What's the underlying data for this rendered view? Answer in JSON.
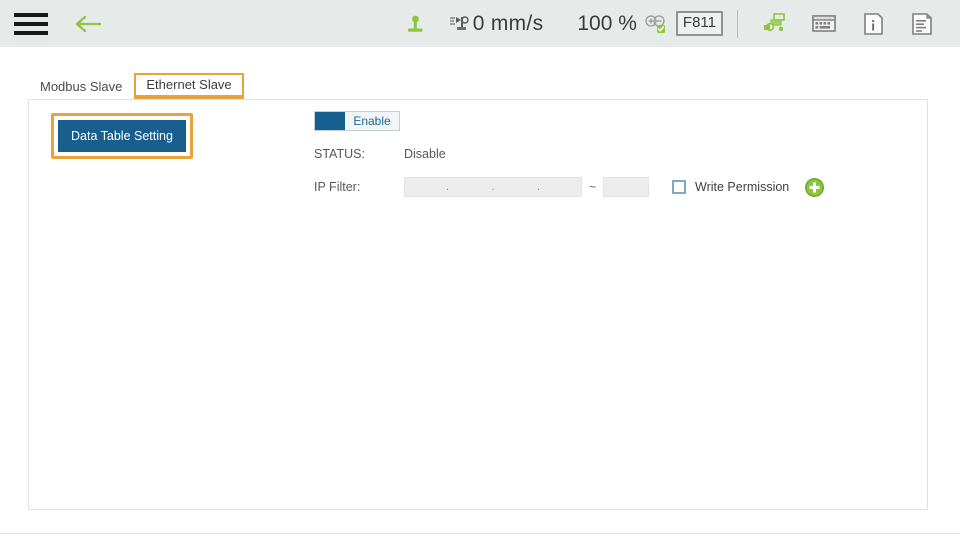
{
  "topbar": {
    "menu_icon": "hamburger-menu-icon",
    "back_icon": "back-arrow-icon",
    "robot_icon": "robot-home-icon",
    "speed_icon": "speed-icon",
    "speed_value": "0 mm/s",
    "zoom_value": "100 %",
    "zoom_icons": "zoom-in-out-icon",
    "frame_label": "F811",
    "program_icon": "program-tree-icon",
    "keyboard_icon": "keyboard-icon",
    "info_icon": "info-icon",
    "log_icon": "log-document-icon"
  },
  "tabs": [
    {
      "label": "Modbus Slave",
      "active": false
    },
    {
      "label": "Ethernet Slave",
      "active": true
    }
  ],
  "panel": {
    "data_table_button": "Data Table Setting",
    "enable_toggle_label": "Enable",
    "status_label": "STATUS:",
    "status_value": "Disable",
    "ip_filter_label": "IP Filter:",
    "ip_filter_value": "",
    "ip_filter_placeholder": "",
    "ip_separator": ".",
    "range_separator": "~",
    "ip_filter_end_value": "",
    "write_permission_label": "Write Permission",
    "write_permission_checked": false,
    "add_icon": "add-plus-icon"
  },
  "colors": {
    "topbar_bg": "#e6eae8",
    "accent_green": "#8cc63e",
    "highlight_orange": "#e8a33d",
    "button_blue": "#185f8d",
    "panel_border": "#e2e2e2"
  }
}
